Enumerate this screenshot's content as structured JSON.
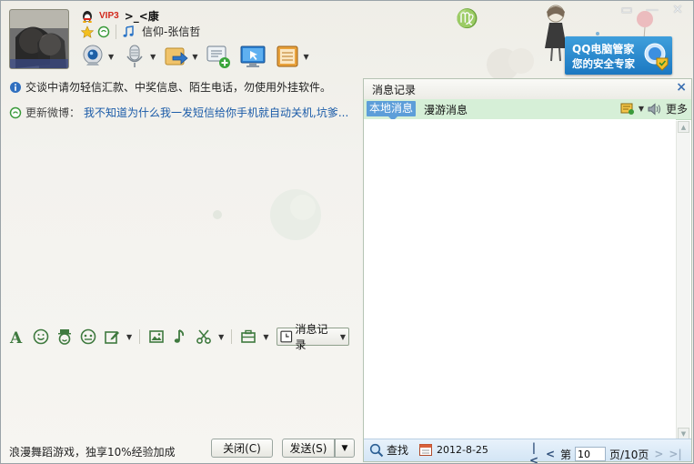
{
  "window": {
    "controls": {
      "minimize": "▭",
      "restore": "—",
      "close": "✕"
    }
  },
  "contact": {
    "vip": "VIP3",
    "nickname": ">_<康",
    "signature": "信仰-张信哲"
  },
  "promo": {
    "line1": "QQ电脑管家",
    "line2": "您的安全专家"
  },
  "chat": {
    "notice": "交谈中请勿轻信汇款、中奖信息、陌生电话，勿使用外挂软件。",
    "weibo_label": "更新微博：",
    "weibo_text": "我不知道为什么我一发短信给你手机就自动关机,坑爹..."
  },
  "input": {
    "history_label": "消息记录",
    "ad_text": "浪漫舞蹈游戏，独享10%经验加成",
    "close_label": "关闭(C)",
    "send_label": "发送(S)"
  },
  "history_panel": {
    "title": "消息记录",
    "tab_local": "本地消息",
    "tab_roam": "漫游消息",
    "more_label": "更多",
    "search_label": "查找",
    "date": "2012-8-25",
    "page_prefix": "第",
    "page_value": "10",
    "page_suffix": "页/10页"
  },
  "colors": {
    "accent_blue": "#1b78c1",
    "tab_active": "#5d9ed9",
    "tab_bar": "#d6efd7",
    "link": "#1b5ba8",
    "vip_red": "#d2271b"
  },
  "icons": {
    "avatar": "avatar",
    "toolbar": [
      "webcam-icon",
      "microphone-icon",
      "file-transfer-icon",
      "chat-add-icon",
      "remote-desktop-icon",
      "app-box-icon"
    ],
    "input_toolbar": [
      "font-icon",
      "emoji-icon",
      "magic-face-icon",
      "doodle-icon",
      "screenshot-edit-icon",
      "image-icon",
      "music-icon",
      "scissors-icon",
      "app-toolbox-icon"
    ]
  }
}
